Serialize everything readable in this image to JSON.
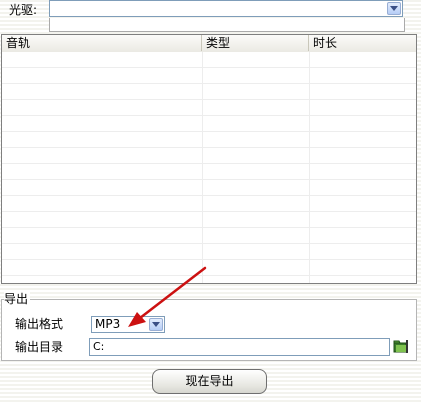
{
  "drive": {
    "label": "光驱:",
    "value": "",
    "info": ""
  },
  "track_list": {
    "columns": [
      "音轨",
      "类型",
      "时长"
    ],
    "rows": []
  },
  "export": {
    "group_title": "导出",
    "format_label": "输出格式",
    "format_value": "MP3",
    "dir_label": "输出目录",
    "dir_value": "C:",
    "button_label": "现在导出"
  },
  "colors": {
    "annotation_arrow": "#cc1111",
    "accent_blue": "#3a6ad4"
  },
  "icons": {
    "combo_dropdown": "chevron-down-icon",
    "browse": "folder-icon"
  }
}
